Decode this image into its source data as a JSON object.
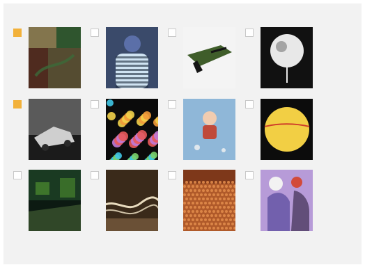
{
  "gallery": {
    "items": [
      {
        "name": "collage-thumb",
        "checked": true,
        "colors": [
          "#9a8a5a",
          "#3b6a3a",
          "#d8c2a0",
          "#6a3a2a"
        ]
      },
      {
        "name": "striped-sweater-thumb",
        "checked": false,
        "colors": [
          "#3a4a6a",
          "#cfe3f2",
          "#b8c9d8",
          "#1a2a3a"
        ]
      },
      {
        "name": "camouflage-object-thumb",
        "checked": false,
        "colors": [
          "#f4f4f4",
          "#3f5d2a",
          "#141414",
          "#a8b4a0"
        ]
      },
      {
        "name": "white-sphere-thumb",
        "checked": false,
        "colors": [
          "#111111",
          "#e8e8e8",
          "#777777",
          "#2a2a2a"
        ]
      },
      {
        "name": "wrecked-car-thumb",
        "checked": true,
        "colors": [
          "#9a9a9a",
          "#cfcfcf",
          "#5a5a5a",
          "#e6e6e6"
        ]
      },
      {
        "name": "colored-dots-thumb",
        "checked": false,
        "colors": [
          "#0b0b0b",
          "#3fc6e6",
          "#f2d24a",
          "#e85a5a"
        ]
      },
      {
        "name": "child-on-floor-thumb",
        "checked": false,
        "colors": [
          "#8fb7d8",
          "#c04a3a",
          "#f1ccb0",
          "#6a8aa8"
        ]
      },
      {
        "name": "yellow-sphere-thumb",
        "checked": false,
        "colors": [
          "#0c0c0c",
          "#f2cf44",
          "#d0402a",
          "#2a2a2a"
        ]
      },
      {
        "name": "green-room-thumb",
        "checked": false,
        "colors": [
          "#0c1a12",
          "#4f8f2f",
          "#1a3a22",
          "#9ad06a"
        ]
      },
      {
        "name": "light-trails-thumb",
        "checked": false,
        "colors": [
          "#3a2a1a",
          "#f2e6c8",
          "#8a6a4a",
          "#1a120c"
        ]
      },
      {
        "name": "crowd-field-thumb",
        "checked": false,
        "colors": [
          "#b05a2a",
          "#6a2a14",
          "#e08a4a",
          "#3a140a"
        ]
      },
      {
        "name": "purple-figures-thumb",
        "checked": false,
        "colors": [
          "#b79bd8",
          "#d24a3a",
          "#f2f2f2",
          "#6a5aa8"
        ]
      }
    ]
  }
}
